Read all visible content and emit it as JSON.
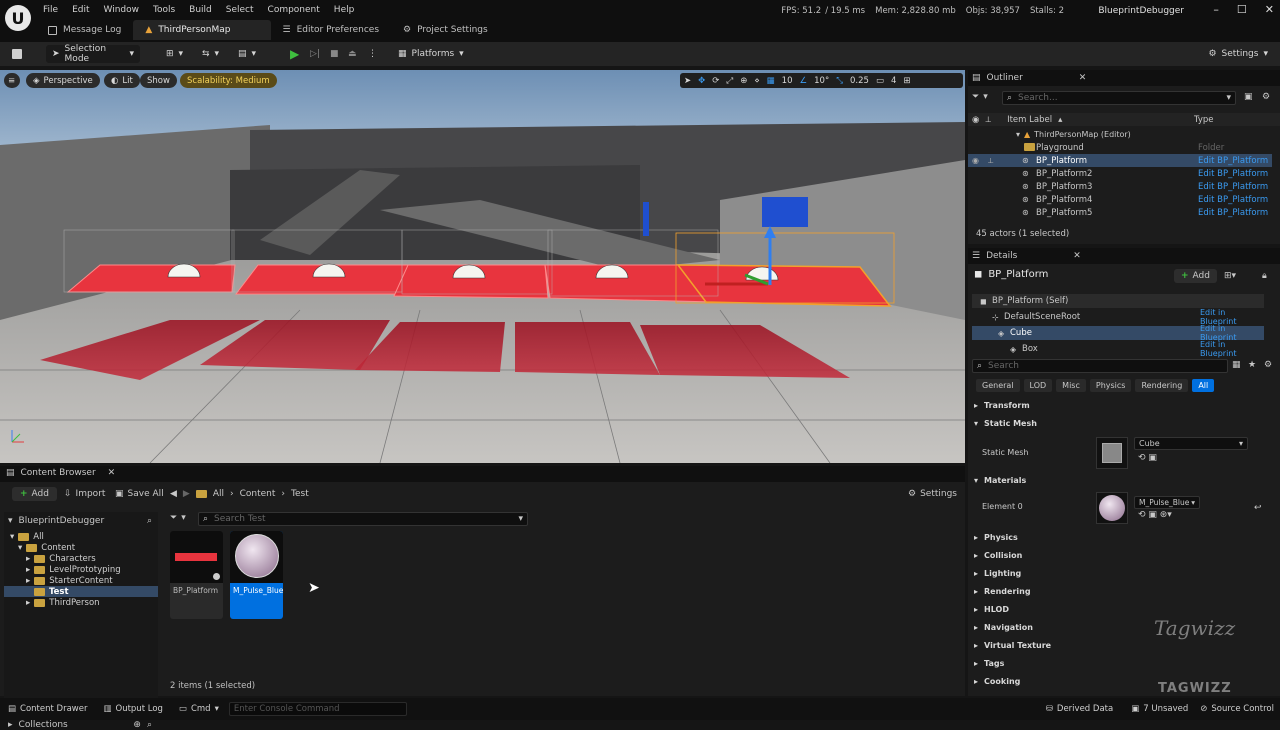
{
  "menu": [
    "File",
    "Edit",
    "Window",
    "Tools",
    "Build",
    "Select",
    "Component",
    "Help"
  ],
  "tabs": [
    {
      "label": "Message Log"
    },
    {
      "label": "ThirdPersonMap"
    },
    {
      "label": "Editor Preferences"
    },
    {
      "label": "Project Settings"
    }
  ],
  "stats": {
    "fps": "FPS: 51.2",
    "ms": "/ 19.5 ms",
    "mem": "Mem: 2,828.80 mb",
    "objs": "Objs: 38,957",
    "stalls": "Stalls: 2"
  },
  "project_name": "BlueprintDebugger",
  "toolbar": {
    "selection_mode": "Selection Mode",
    "platforms": "Platforms",
    "settings": "Settings"
  },
  "viewport": {
    "perspective": "Perspective",
    "lit": "Lit",
    "show": "Show",
    "scalability": "Scalability: Medium",
    "grid_snap": "10",
    "rot_snap": "10°",
    "scale_snap": "0.25",
    "cam_speed": "4"
  },
  "content_browser": {
    "tab_label": "Content Browser",
    "add": "Add",
    "import": "Import",
    "save_all": "Save All",
    "breadcrumb": [
      "All",
      "Content",
      "Test"
    ],
    "settings": "Settings",
    "project": "BlueprintDebugger",
    "tree": [
      "All",
      "Content",
      "Characters",
      "LevelPrototyping",
      "StarterContent",
      "Test",
      "ThirdPerson"
    ],
    "search_placeholder": "Search Test",
    "assets": [
      {
        "name": "BP_Platform"
      },
      {
        "name": "M_Pulse_Blue"
      }
    ],
    "item_count": "2 items (1 selected)",
    "collections": "Collections"
  },
  "outliner": {
    "tab_label": "Outliner",
    "search_placeholder": "Search...",
    "col_label": "Item Label",
    "col_type": "Type",
    "map": "ThirdPersonMap (Editor)",
    "rows": [
      {
        "label": "Playground",
        "type": "Folder"
      },
      {
        "label": "BP_Platform",
        "type": "Edit BP_Platform"
      },
      {
        "label": "BP_Platform2",
        "type": "Edit BP_Platform"
      },
      {
        "label": "BP_Platform3",
        "type": "Edit BP_Platform"
      },
      {
        "label": "BP_Platform4",
        "type": "Edit BP_Platform"
      },
      {
        "label": "BP_Platform5",
        "type": "Edit BP_Platform"
      }
    ],
    "count": "45 actors (1 selected)"
  },
  "details": {
    "tab_label": "Details",
    "actor": "BP_Platform",
    "add": "Add",
    "components": [
      {
        "label": "BP_Platform (Self)",
        "action": ""
      },
      {
        "label": "DefaultSceneRoot",
        "action": "Edit in Blueprint"
      },
      {
        "label": "Cube",
        "action": "Edit in Blueprint"
      },
      {
        "label": "Box",
        "action": "Edit in Blueprint"
      }
    ],
    "search_placeholder": "Search",
    "filters": [
      "General",
      "LOD",
      "Misc",
      "Physics",
      "Rendering",
      "All"
    ],
    "transform": "Transform",
    "static_mesh_section": "Static Mesh",
    "static_mesh_label": "Static Mesh",
    "static_mesh_value": "Cube",
    "materials_section": "Materials",
    "element0_label": "Element 0",
    "element0_value": "M_Pulse_Blue",
    "sections": [
      "Physics",
      "Collision",
      "Lighting",
      "Rendering",
      "HLOD",
      "Navigation",
      "Virtual Texture",
      "Tags",
      "Cooking"
    ]
  },
  "status": {
    "content_drawer": "Content Drawer",
    "output_log": "Output Log",
    "cmd": "Cmd",
    "console_placeholder": "Enter Console Command",
    "derived_data": "Derived Data",
    "unsaved": "7 Unsaved",
    "source_control": "Source Control"
  },
  "watermark": "TAGWIZZ",
  "colors": {
    "accent": "#0070e0",
    "link": "#3a9af0",
    "platform_red": "#e8343e",
    "folder": "#c9a23f"
  }
}
